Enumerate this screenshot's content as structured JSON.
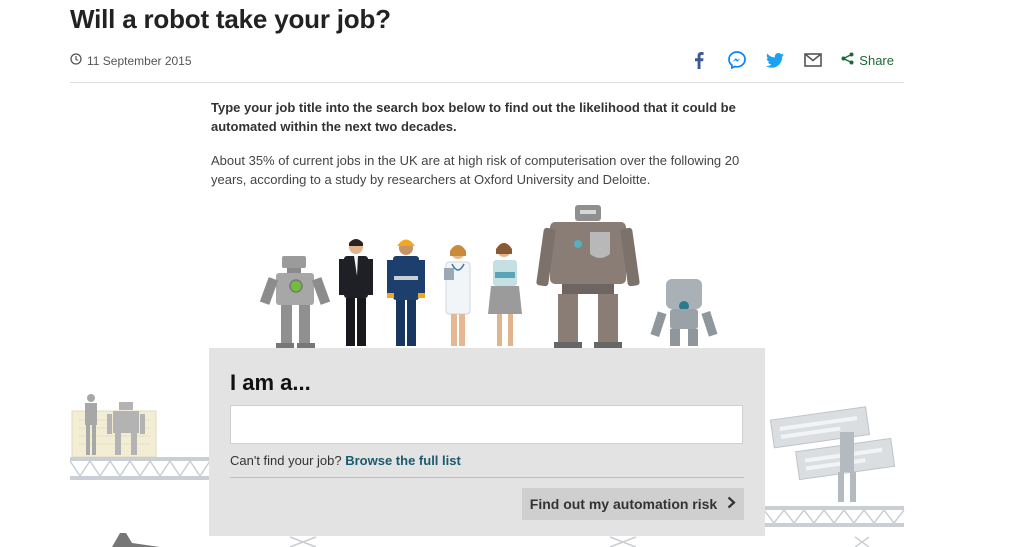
{
  "article": {
    "headline": "Will a robot take your job?",
    "date": "11 September 2015",
    "intro": "Type your job title into the search box below to find out the likelihood that it could be automated within the next two decades.",
    "body": "About 35% of current jobs in the UK are at high risk of computerisation over the following 20 years, according to a study by researchers at Oxford University and Deloitte."
  },
  "share": {
    "icons": [
      "facebook-icon",
      "messenger-icon",
      "twitter-icon",
      "email-icon"
    ],
    "label": "Share"
  },
  "calculator": {
    "title": "I am a...",
    "input_value": "",
    "input_placeholder": "",
    "cant_find_prefix": "Can't find your job?",
    "cant_find_link": "Browse the full list",
    "button_label": "Find out my automation risk"
  },
  "colors": {
    "facebook": "#3b5998",
    "messenger": "#0084ff",
    "twitter": "#1da1f2",
    "share_green": "#1a6a38",
    "link_teal": "#1b5a6e",
    "panel_bg": "#e3e3e3"
  }
}
